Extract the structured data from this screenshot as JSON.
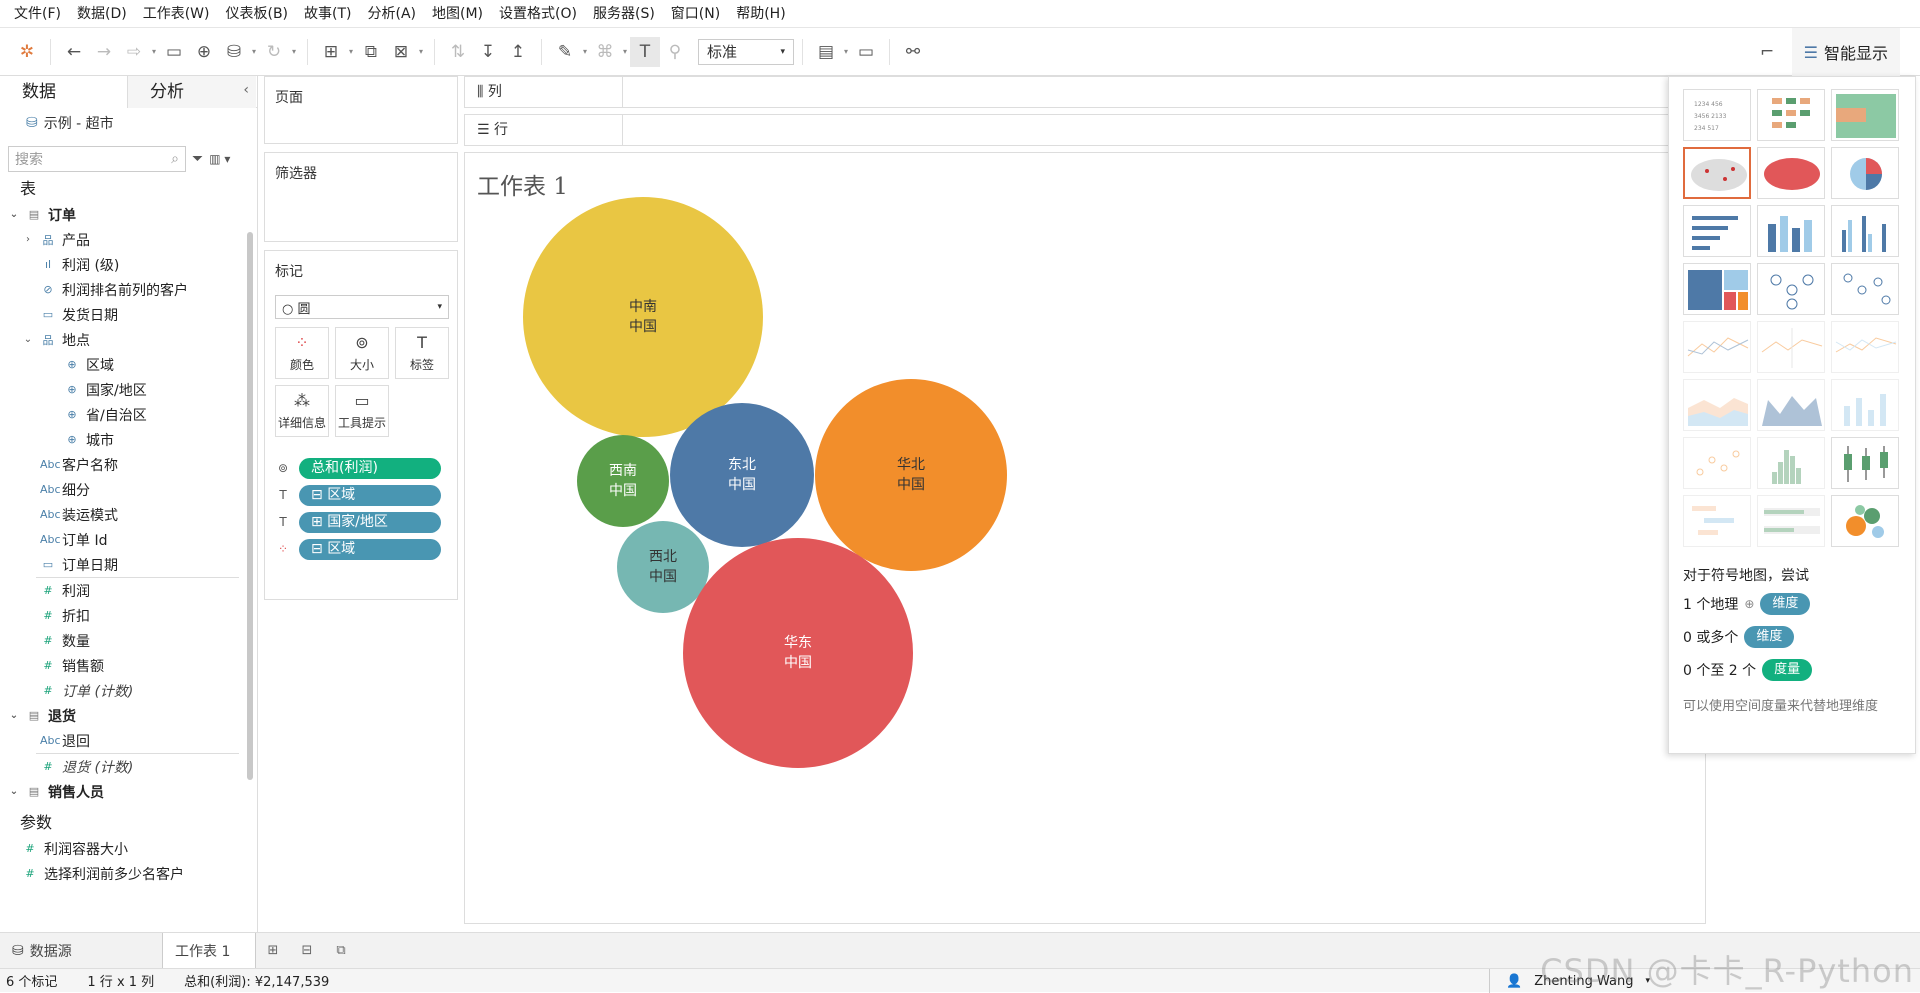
{
  "menu": [
    "文件(F)",
    "数据(D)",
    "工作表(W)",
    "仪表板(B)",
    "故事(T)",
    "分析(A)",
    "地图(M)",
    "设置格式(O)",
    "服务器(S)",
    "窗口(N)",
    "帮助(H)"
  ],
  "toolbar": {
    "fit_value": "标准",
    "show_me_label": "智能显示"
  },
  "left": {
    "tab_data": "数据",
    "tab_analytics": "分析",
    "datasource": "示例 - 超市",
    "search_placeholder": "搜索",
    "tables_header": "表",
    "tables": [
      {
        "name": "订单",
        "fields": [
          {
            "name": "产品",
            "icon": "hierarchy",
            "indent": 1,
            "expand": "collapsed"
          },
          {
            "name": "利润 (级)",
            "icon": "bin",
            "indent": 1
          },
          {
            "name": "利润排名前列的客户",
            "icon": "set",
            "indent": 1
          },
          {
            "name": "发货日期",
            "icon": "date",
            "indent": 1
          },
          {
            "name": "地点",
            "icon": "hierarchy",
            "indent": 1,
            "expand": "expanded"
          },
          {
            "name": "区域",
            "icon": "geo",
            "indent": 2
          },
          {
            "name": "国家/地区",
            "icon": "geo",
            "indent": 2
          },
          {
            "name": "省/自治区",
            "icon": "geo",
            "indent": 2
          },
          {
            "name": "城市",
            "icon": "geo",
            "indent": 2
          },
          {
            "name": "客户名称",
            "icon": "abc",
            "indent": 1
          },
          {
            "name": "细分",
            "icon": "abc",
            "indent": 1
          },
          {
            "name": "装运模式",
            "icon": "abc",
            "indent": 1
          },
          {
            "name": "订单 Id",
            "icon": "abc",
            "indent": 1
          },
          {
            "name": "订单日期",
            "icon": "date",
            "indent": 1
          },
          {
            "name": "利润",
            "icon": "measure",
            "indent": 1,
            "sep_before": true
          },
          {
            "name": "折扣",
            "icon": "measure",
            "indent": 1
          },
          {
            "name": "数量",
            "icon": "measure",
            "indent": 1
          },
          {
            "name": "销售额",
            "icon": "measure",
            "indent": 1
          },
          {
            "name": "订单 (计数)",
            "icon": "measure",
            "indent": 1,
            "italic": true
          }
        ]
      },
      {
        "name": "退货",
        "fields": [
          {
            "name": "退回",
            "icon": "abc",
            "indent": 1
          },
          {
            "name": "退货 (计数)",
            "icon": "measure",
            "indent": 1,
            "italic": true,
            "sep_before": true
          }
        ]
      },
      {
        "name": "销售人员",
        "fields": []
      }
    ],
    "params_header": "参数",
    "params": [
      "利润容器大小",
      "选择利润前多少名客户"
    ]
  },
  "cards": {
    "pages": "页面",
    "filters": "筛选器",
    "marks": "标记",
    "mark_type": "圆",
    "mark_buttons": [
      "颜色",
      "大小",
      "标签",
      "详细信息",
      "工具提示"
    ],
    "mark_pills": [
      {
        "label": "总和(利润)",
        "kind": "green",
        "role": "size-icon"
      },
      {
        "label": "区域",
        "kind": "blue",
        "role": "label-icon"
      },
      {
        "label": "国家/地区",
        "kind": "blue",
        "role": "label-icon"
      },
      {
        "label": "区域",
        "kind": "blue",
        "role": "color-icon"
      }
    ]
  },
  "shelves": {
    "columns": "列",
    "rows": "行"
  },
  "view": {
    "title": "工作表 1",
    "bubbles": [
      {
        "region": "中南",
        "country": "中国",
        "color": "#e9c643",
        "text_color": "#333333"
      },
      {
        "region": "西南",
        "country": "中国",
        "color": "#5a9e4a",
        "text_color": "#ffffff"
      },
      {
        "region": "东北",
        "country": "中国",
        "color": "#4e79a7",
        "text_color": "#ffffff"
      },
      {
        "region": "华北",
        "country": "中国",
        "color": "#f28e2b",
        "text_color": "#333333"
      },
      {
        "region": "西北",
        "country": "中国",
        "color": "#76b7b2",
        "text_color": "#333333"
      },
      {
        "region": "华东",
        "country": "中国",
        "color": "#e15759",
        "text_color": "#ffffff"
      }
    ]
  },
  "show_me": {
    "hint_title": "对于符号地图，尝试",
    "hints": [
      {
        "prefix": "1 个地理",
        "pill": "维度",
        "kind": "blue"
      },
      {
        "prefix": "0 或多个",
        "pill": "维度",
        "kind": "blue"
      },
      {
        "prefix": "0 个至 2 个",
        "pill": "度量",
        "kind": "green"
      }
    ],
    "note": "可以使用空间度量来代替地理维度"
  },
  "bottom": {
    "datasource_tab": "数据源",
    "sheet_tab": "工作表 1"
  },
  "status": {
    "marks": "6 个标记",
    "rowscols": "1 行 x 1 列",
    "sum": "总和(利润): ¥2,147,539",
    "user": "Zhenting Wang"
  },
  "watermark": "CSDN @卡卡_R-Python",
  "colors": {
    "green_pill": "#12b07f",
    "blue_pill": "#4996b2",
    "selected_border": "#e06b3d"
  }
}
